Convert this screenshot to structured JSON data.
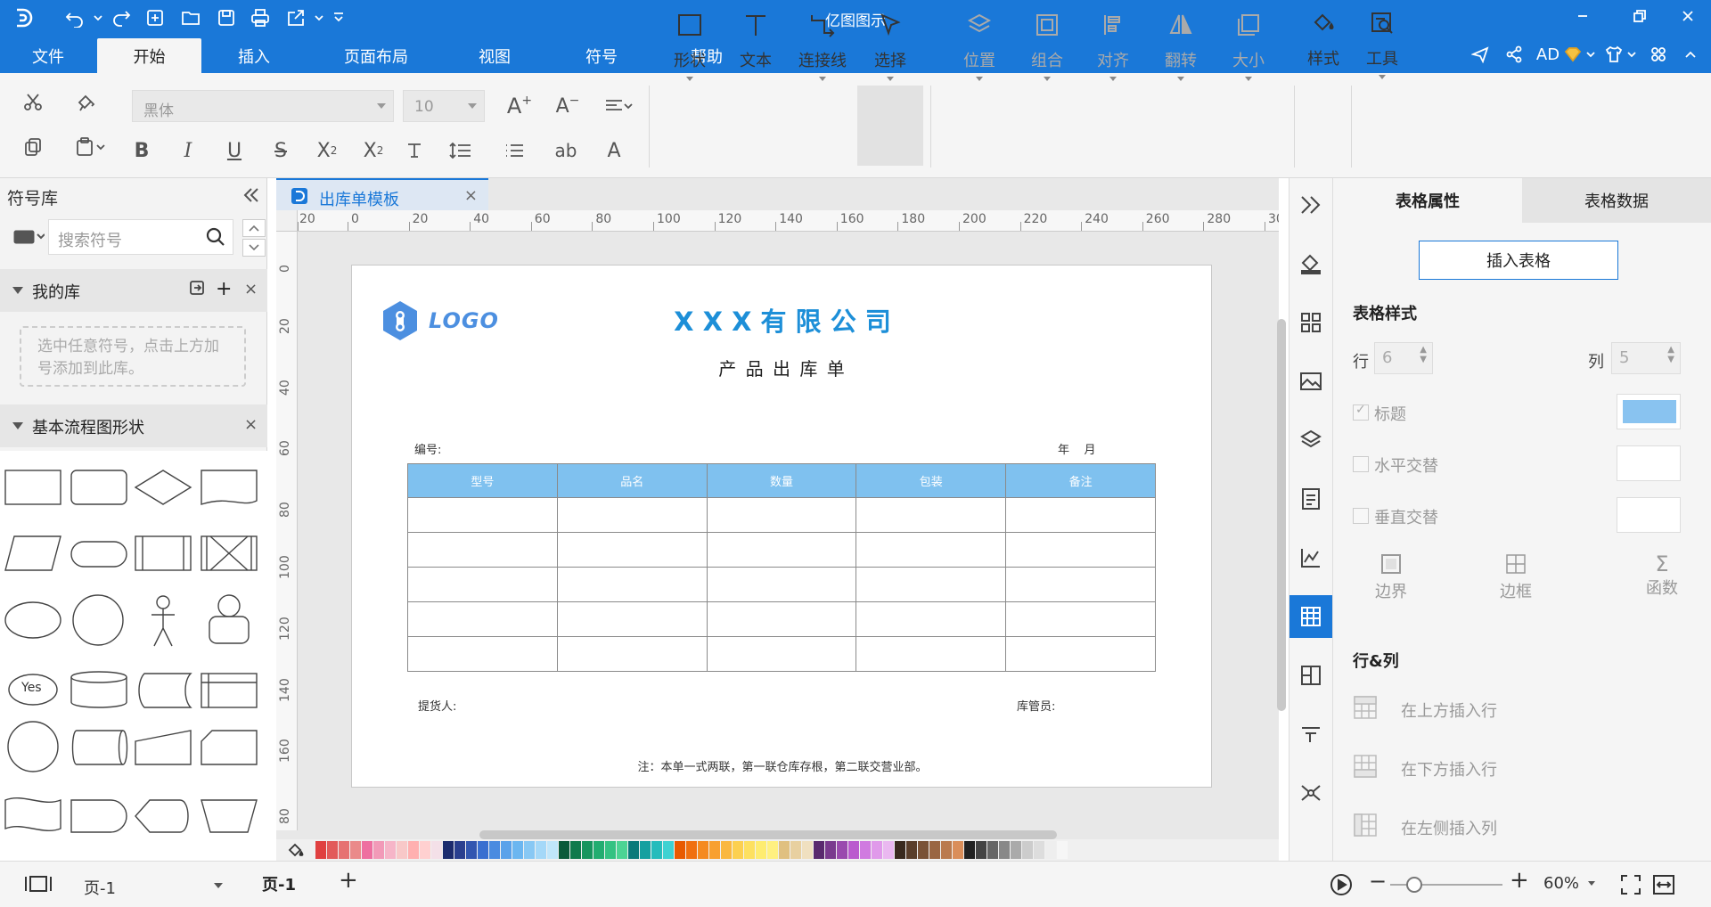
{
  "app": {
    "title": "亿图图示"
  },
  "menu": {
    "tabs": [
      "文件",
      "开始",
      "插入",
      "页面布局",
      "视图",
      "符号",
      "帮助"
    ],
    "user": "AD"
  },
  "ribbon": {
    "font_name": "黑体",
    "font_size": "10",
    "tools": {
      "shape": "形状",
      "text": "文本",
      "connector": "连接线",
      "select": "选择",
      "position": "位置",
      "group": "组合",
      "align": "对齐",
      "flip": "翻转",
      "size": "大小",
      "style": "样式",
      "tools": "工具"
    }
  },
  "left_panel": {
    "title": "符号库",
    "search_placeholder": "搜索符号",
    "my_library": "我的库",
    "my_library_hint": "选中任意符号，点击上方加号添加到此库。",
    "basic_flowchart": "基本流程图形状",
    "yes_label": "Yes"
  },
  "document": {
    "tab_name": "出库单模板",
    "logo_text": "LOGO",
    "company": "X X X 有 限 公 司",
    "subtitle": "产 品 出 库 单",
    "number_label": "编号:",
    "date_label": "年    月",
    "table_headers": [
      "型号",
      "品名",
      "数量",
      "包装",
      "备注"
    ],
    "table_rows": 5,
    "picker_label": "提货人:",
    "keeper_label": "库管员:",
    "note": "注：本单一式两联，第一联仓库存根，第二联交营业部。"
  },
  "ruler": {
    "h_ticks": [
      "20",
      "0",
      "20",
      "40",
      "60",
      "80",
      "100",
      "120",
      "140",
      "160",
      "180",
      "200",
      "220",
      "240",
      "260",
      "280",
      "30"
    ],
    "v_ticks": [
      "0",
      "20",
      "40",
      "60",
      "80",
      "100",
      "120",
      "140",
      "160",
      "80"
    ]
  },
  "right_panel": {
    "tab_props": "表格属性",
    "tab_data": "表格数据",
    "insert_table": "插入表格",
    "table_style": "表格样式",
    "rows_label": "行",
    "rows_value": "6",
    "cols_label": "列",
    "cols_value": "5",
    "title_chk": "标题",
    "horiz_alt": "水平交替",
    "vert_alt": "垂直交替",
    "edge": "边界",
    "border": "边框",
    "func": "函数",
    "rowcol": "行&列",
    "insert_above": "在上方插入行",
    "insert_below": "在下方插入行",
    "insert_left": "在左侧插入列",
    "title_color": "#89c3f0"
  },
  "status": {
    "page_select": "页-1",
    "page_tab": "页-1",
    "zoom": "60%"
  },
  "colors": {
    "accent": "#1a78d8",
    "header_fill": "#7fc1ef",
    "title_blue": "#1d8fd8"
  }
}
